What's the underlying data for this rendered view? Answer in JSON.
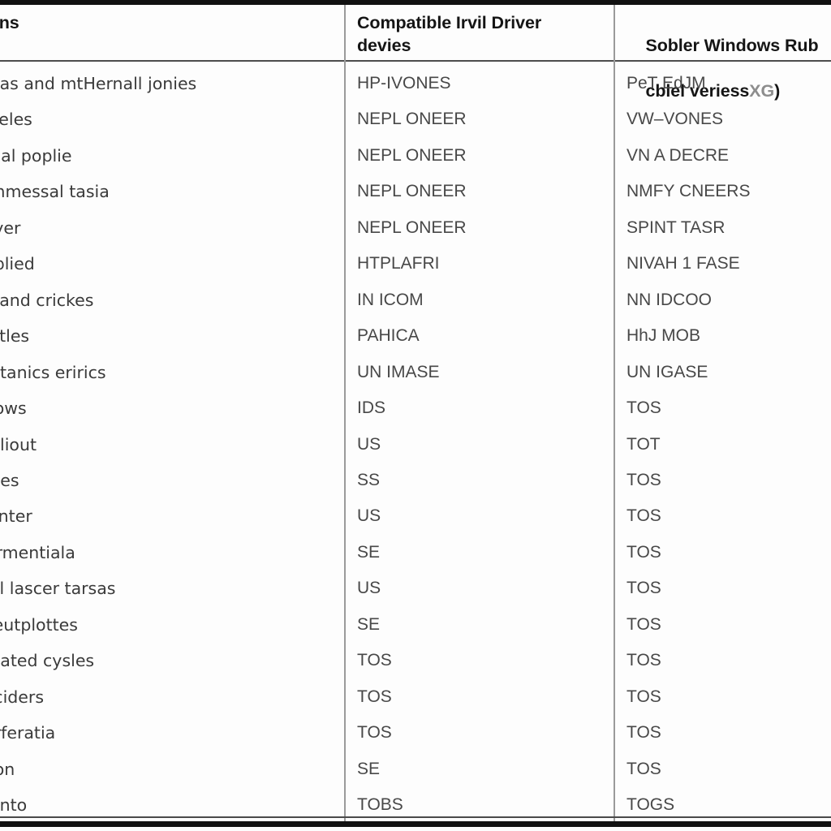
{
  "table": {
    "headers": [
      "signs",
      "Compatible Irvil Driver\ndevies",
      "Sobler Windows Rub"
    ],
    "header_sub_col3": "cblel veriess",
    "header_sub_col3_faint": "XG",
    "header_sub_col3_tail": ")",
    "columns": 3,
    "row_count": 21,
    "rows": [
      {
        "c0": "neas and mtHernall jonies",
        "c1": "HP-IVONES",
        "c2": "PeT EdJM"
      },
      {
        "c0": "nceles",
        "c1": "NEPL ONEER",
        "c2": "VW–VONES"
      },
      {
        "c0": "drial poplie",
        "c1": "NEPL ONEER",
        "c2": "VN A DECRE"
      },
      {
        "c0": "ommessal tasia",
        "c1": "NEPL ONEER",
        "c2": "NMFY CNEERS"
      },
      {
        "c0": "loyer",
        "c1": "NEPL ONEER",
        "c2": "SPINT TASR"
      },
      {
        "c0": "juplied",
        "c1": "HTPLAFRI",
        "c2": "NIVAH 1 FASE"
      },
      {
        "c0": "id and crickes",
        "c1": "IN ICOM",
        "c2": "NN IDCOO"
      },
      {
        "c0": "ootles",
        "c1": "PAHICA",
        "c2": "HhJ MOB"
      },
      {
        "c0": "ghtanics erirics",
        "c1": "UN IMASE",
        "c2": "UN IGASE"
      },
      {
        "c0": "plows",
        "c1": "IDS",
        "c2": "TOS"
      },
      {
        "c0": "ppliout",
        "c1": "US",
        "c2": "TOT"
      },
      {
        "c0": "iroes",
        "c1": "SS",
        "c2": "TOS"
      },
      {
        "c0": "sunter",
        "c1": "US",
        "c2": "TOS"
      },
      {
        "c0": "orrmentiala",
        "c1": "SE",
        "c2": "TOS"
      },
      {
        "c0": "nal lascer tarsas",
        "c1": "US",
        "c2": "TOS"
      },
      {
        "c0": "Meutplottes",
        "c1": "SE",
        "c2": "TOS"
      },
      {
        "c0": "atlated cysles",
        "c1": "TOS",
        "c2": "TOS"
      },
      {
        "c0": "leciders",
        "c1": "TOS",
        "c2": "TOS"
      },
      {
        "c0": "inrferatia",
        "c1": "TOS",
        "c2": "TOS"
      },
      {
        "c0": "ston",
        "c1": "SE",
        "c2": "TOS"
      },
      {
        "c0": "nento",
        "c1": "TOBS",
        "c2": "TOGS"
      }
    ]
  },
  "style": {
    "page_background": "#fdfdfd",
    "rule_color": "#111111",
    "divider_color": "#9a9a9a",
    "header_text_color": "#151515",
    "body_text_color": "#3d3d3d"
  }
}
